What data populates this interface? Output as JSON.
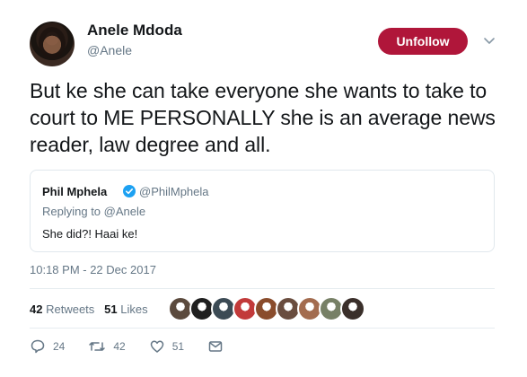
{
  "author": {
    "name": "Anele Mdoda",
    "handle": "@Anele"
  },
  "follow_button_label": "Unfollow",
  "tweet_text": "But ke she can take everyone she wants to take to court to ME PERSONALLY she is an average news reader, law degree and all.",
  "quoted_tweet": {
    "name": "Phil Mphela",
    "handle": "@PhilMphela",
    "replying_to": "Replying to @Anele",
    "text": "She did?! Haai ke!"
  },
  "timestamp": "10:18 PM - 22 Dec 2017",
  "stats": {
    "retweets_count": "42",
    "retweets_label": "Retweets",
    "likes_count": "51",
    "likes_label": "Likes"
  },
  "likers": [
    {
      "icon": "liker-avatar",
      "color": "#5b4a3d"
    },
    {
      "icon": "liker-avatar",
      "color": "#1f1f1f"
    },
    {
      "icon": "liker-avatar",
      "color": "#3c4b55"
    },
    {
      "icon": "liker-avatar",
      "color": "#c23a3a"
    },
    {
      "icon": "liker-avatar",
      "color": "#8a4c2c"
    },
    {
      "icon": "liker-avatar",
      "color": "#6a4d3f"
    },
    {
      "icon": "liker-avatar",
      "color": "#a36c4f"
    },
    {
      "icon": "liker-avatar",
      "color": "#778066"
    },
    {
      "icon": "liker-avatar",
      "color": "#3a2f2a"
    }
  ],
  "actions": {
    "reply_count": "24",
    "retweet_count": "42",
    "like_count": "51"
  },
  "colors": {
    "unfollow_bg": "#b0163a",
    "secondary_text": "#657786",
    "verified": "#1da1f2"
  }
}
